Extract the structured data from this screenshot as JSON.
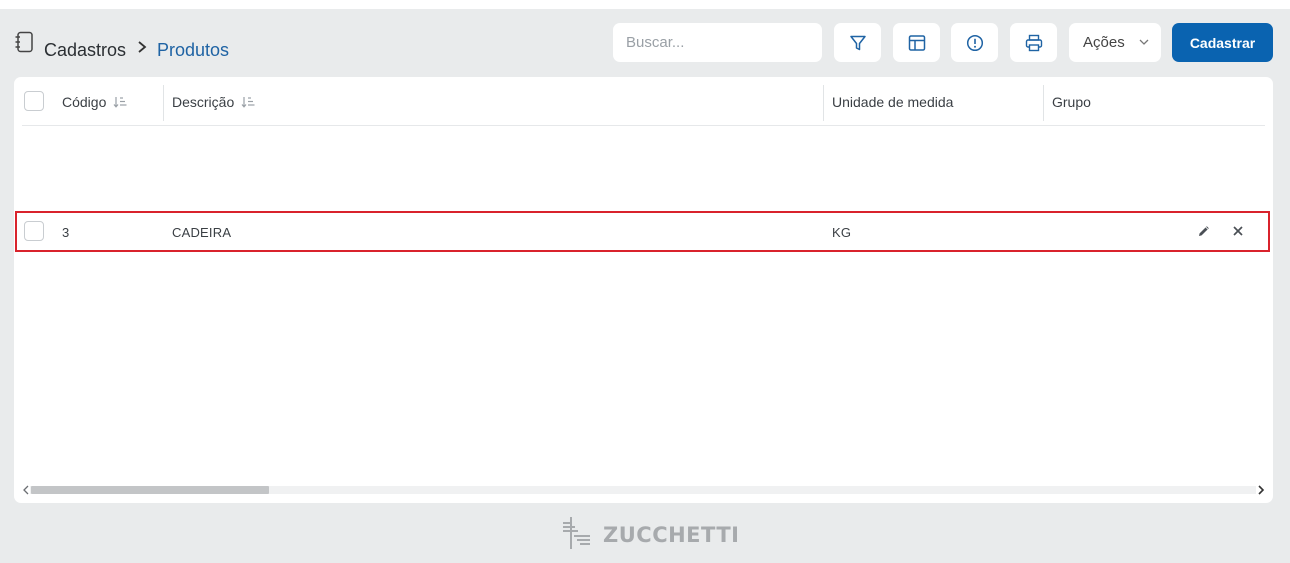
{
  "breadcrumb": {
    "icon": "register-book-icon",
    "root": "Cadastros",
    "separator_icon": "chevron-right-icon",
    "current": "Produtos"
  },
  "toolbar": {
    "search_placeholder": "Buscar...",
    "buttons": [
      {
        "icon": "filter-icon"
      },
      {
        "icon": "columns-layout-icon"
      },
      {
        "icon": "info-icon"
      },
      {
        "icon": "print-icon"
      }
    ],
    "actions_label": "Ações",
    "actions_icon": "chevron-down-icon",
    "primary_button": "Cadastrar",
    "accent_color": "#0a63b0"
  },
  "table": {
    "columns": [
      {
        "label": "Código",
        "sortable": true
      },
      {
        "label": "Descrição",
        "sortable": true
      },
      {
        "label": "Unidade de medida",
        "sortable": false
      },
      {
        "label": "Grupo",
        "sortable": false
      }
    ],
    "rows": [
      {
        "codigo": "3",
        "descricao": "CADEIRA",
        "unidade": "KG",
        "grupo": "",
        "highlighted": true,
        "highlight_color": "#d9232c"
      }
    ],
    "row_actions": [
      "pencil-edit-icon",
      "close-icon"
    ]
  },
  "footer": {
    "brand": "ZUCCHETTI"
  }
}
